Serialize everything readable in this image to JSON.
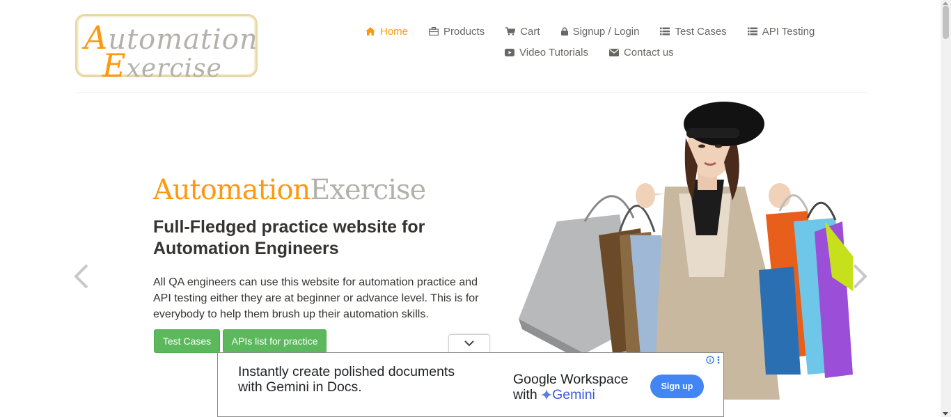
{
  "logo": {
    "line1_first": "A",
    "line1_rest": "utomation",
    "line2_first": "E",
    "line2_rest": "xercise"
  },
  "nav": {
    "items": [
      {
        "label": "Home",
        "icon": "home-icon",
        "active": true
      },
      {
        "label": "Products",
        "icon": "products-icon"
      },
      {
        "label": "Cart",
        "icon": "cart-icon"
      },
      {
        "label": "Signup / Login",
        "icon": "lock-icon"
      },
      {
        "label": "Test Cases",
        "icon": "list-icon"
      },
      {
        "label": "API Testing",
        "icon": "list-icon"
      },
      {
        "label": "Video Tutorials",
        "icon": "youtube-icon"
      },
      {
        "label": "Contact us",
        "icon": "envelope-icon"
      }
    ]
  },
  "hero": {
    "brand_a": "Automation",
    "brand_b": "Exercise",
    "title": "Full-Fledged practice website for Automation Engineers",
    "description": "All QA engineers can use this website for automation practice and API testing either they are at beginner or advance level. This is for everybody to help them brush up their automation skills.",
    "btn_test_cases": "Test Cases",
    "btn_apis": "APIs list for practice"
  },
  "ad": {
    "line1": "Instantly create polished documents",
    "line2": "with Gemini in Docs.",
    "brand_line1": "Google Workspace",
    "brand_with": "with",
    "brand_gemini": "Gemini",
    "cta": "Sign up"
  },
  "colors": {
    "accent": "#fe980f",
    "button": "#5cb85c",
    "text": "#696763",
    "ad_cta": "#4285f4"
  }
}
